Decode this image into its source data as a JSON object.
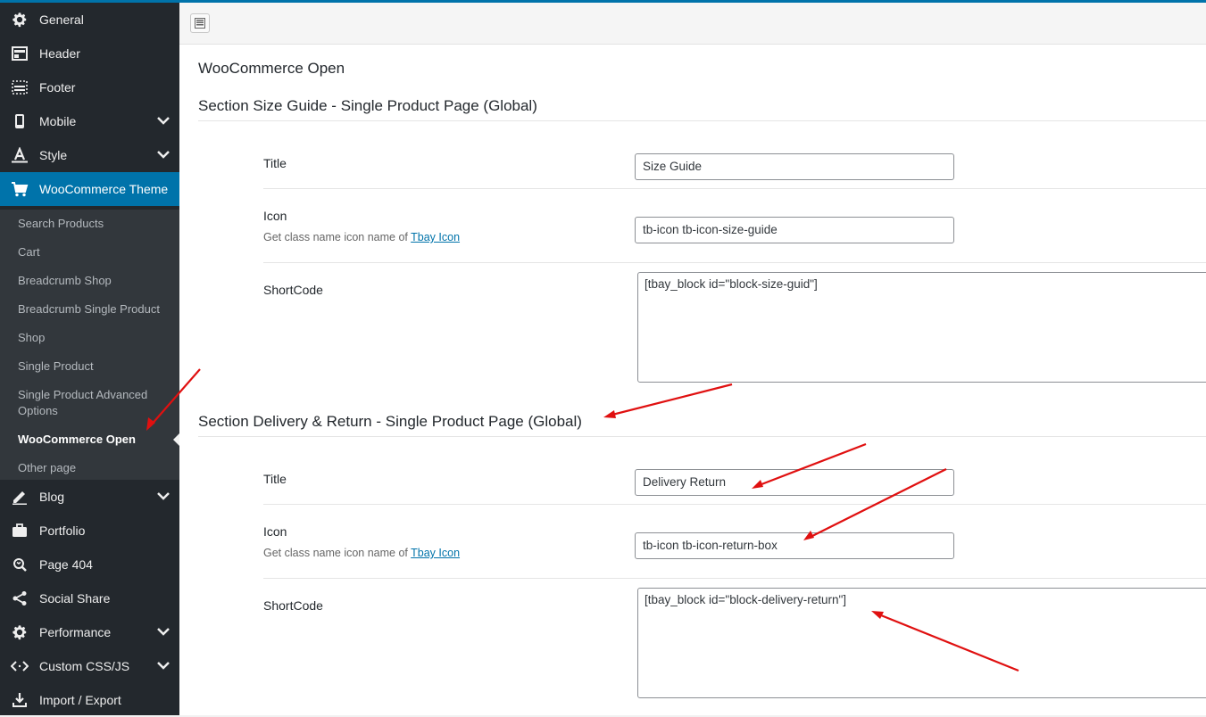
{
  "sidebar": {
    "items": [
      {
        "label": "General",
        "icon": "gear-icon"
      },
      {
        "label": "Header",
        "icon": "header-icon"
      },
      {
        "label": "Footer",
        "icon": "footer-icon"
      },
      {
        "label": "Mobile",
        "icon": "mobile-icon"
      },
      {
        "label": "Style",
        "icon": "text-style-icon"
      },
      {
        "label": "WooCommerce Theme",
        "icon": "cart-icon"
      },
      {
        "label": "Blog",
        "icon": "pen-icon"
      },
      {
        "label": "Portfolio",
        "icon": "briefcase-icon"
      },
      {
        "label": "Page 404",
        "icon": "search-refresh-icon"
      },
      {
        "label": "Social Share",
        "icon": "share-icon"
      },
      {
        "label": "Performance",
        "icon": "gear-icon"
      },
      {
        "label": "Custom CSS/JS",
        "icon": "code-icon"
      },
      {
        "label": "Import / Export",
        "icon": "download-icon"
      }
    ],
    "subitems": [
      {
        "label": "Search Products"
      },
      {
        "label": "Cart"
      },
      {
        "label": "Breadcrumb Shop"
      },
      {
        "label": "Breadcrumb Single Product"
      },
      {
        "label": "Shop"
      },
      {
        "label": "Single Product"
      },
      {
        "label": "Single Product Advanced Options"
      },
      {
        "label": "WooCommerce Open"
      },
      {
        "label": "Other page"
      }
    ]
  },
  "main": {
    "page_title": "WooCommerce Open",
    "sections": [
      {
        "title": "Section Size Guide - Single Product Page (Global)",
        "fields": {
          "title_label": "Title",
          "title_value": "Size Guide",
          "icon_label": "Icon",
          "icon_desc": "Get class name icon name of",
          "icon_link": "Tbay Icon",
          "icon_value": "tb-icon tb-icon-size-guide",
          "shortcode_label": "ShortCode",
          "shortcode_value": "[tbay_block id=\"block-size-guid\"]"
        }
      },
      {
        "title": "Section Delivery & Return - Single Product Page (Global)",
        "fields": {
          "title_label": "Title",
          "title_value": "Delivery Return",
          "icon_label": "Icon",
          "icon_desc": "Get class name icon name of",
          "icon_link": "Tbay Icon",
          "icon_value": "tb-icon tb-icon-return-box",
          "shortcode_label": "ShortCode",
          "shortcode_value": "[tbay_block id=\"block-delivery-return\"]"
        }
      }
    ]
  },
  "colors": {
    "sidebar_bg": "#23282d",
    "submenu_bg": "#32373c",
    "accent": "#0073aa",
    "annotation_arrow": "#e01010"
  }
}
